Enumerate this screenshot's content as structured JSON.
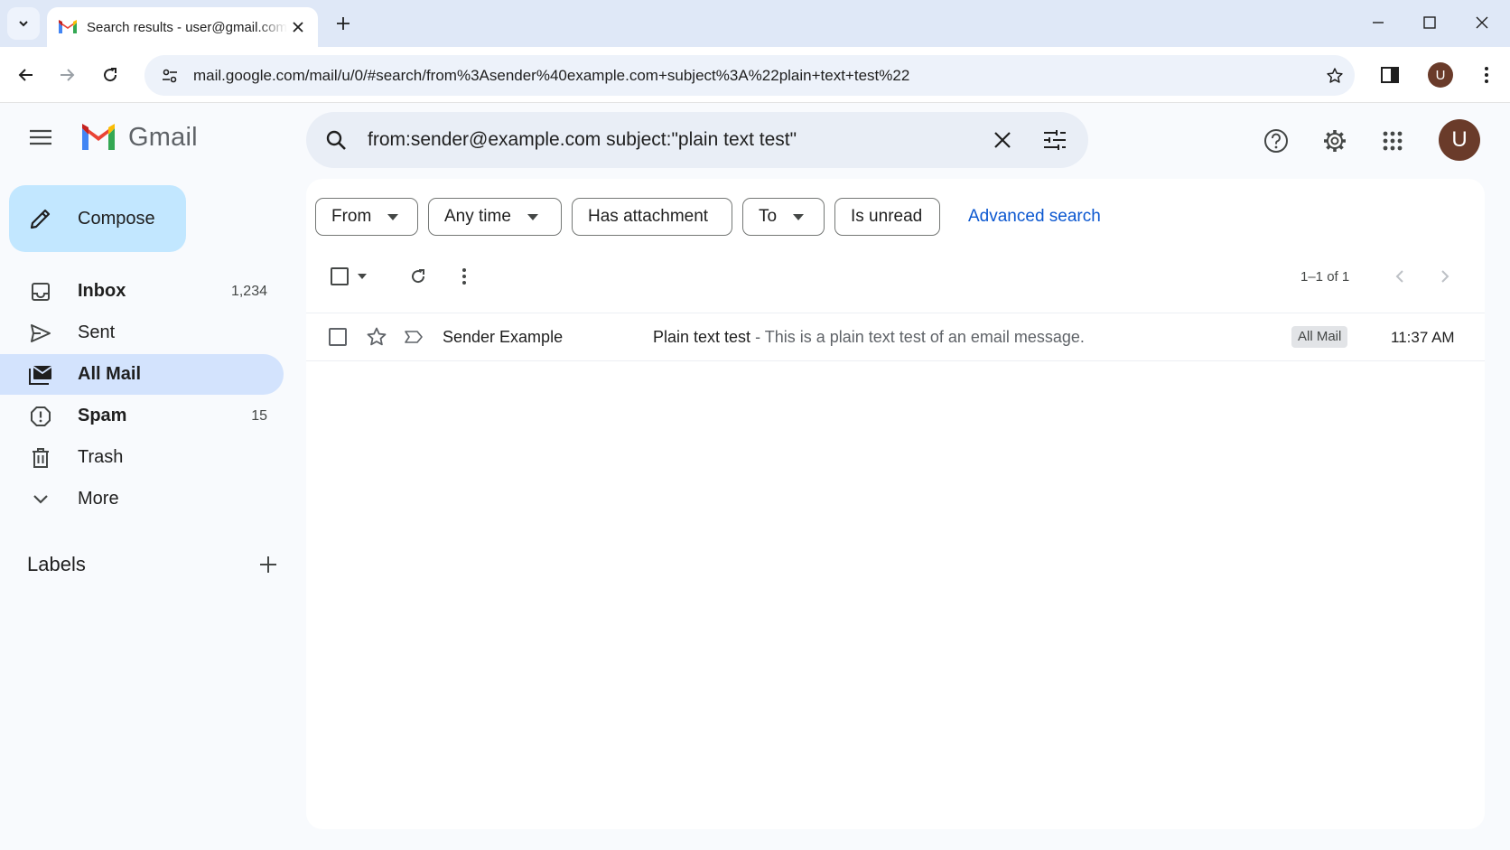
{
  "browser": {
    "tab_title": "Search results - user@gmail.com",
    "url": "mail.google.com/mail/u/0/#search/from%3Asender%40example.com+subject%3A%22plain+text+test%22",
    "profile_initial": "U"
  },
  "gmail": {
    "logo_text": "Gmail",
    "search_query": "from:sender@example.com subject:\"plain text test\"",
    "account_initial": "U",
    "compose_label": "Compose",
    "nav": [
      {
        "label": "Inbox",
        "count": "1,234",
        "icon": "inbox-icon"
      },
      {
        "label": "Sent",
        "count": "",
        "icon": "send-icon"
      },
      {
        "label": "All Mail",
        "count": "",
        "icon": "all-mail-icon"
      },
      {
        "label": "Spam",
        "count": "15",
        "icon": "spam-icon"
      },
      {
        "label": "Trash",
        "count": "",
        "icon": "trash-icon"
      },
      {
        "label": "More",
        "count": "",
        "icon": "chevron-down-icon"
      }
    ],
    "labels_title": "Labels"
  },
  "filters": {
    "chips": [
      "From",
      "Any time",
      "Has attachment",
      "To",
      "Is unread"
    ],
    "advanced_search": "Advanced search"
  },
  "results": {
    "range": "1–1 of 1",
    "emails": [
      {
        "sender": "Sender Example",
        "subject": "Plain text test",
        "snippet": "- This is a plain text test of an email message.",
        "label": "All Mail",
        "time": "11:37 AM"
      }
    ]
  },
  "colors": {
    "selected_nav": "#d3e3fd",
    "compose_bg": "#c2e7ff",
    "link": "#0b57d0",
    "avatar": "#6a3b2a"
  }
}
